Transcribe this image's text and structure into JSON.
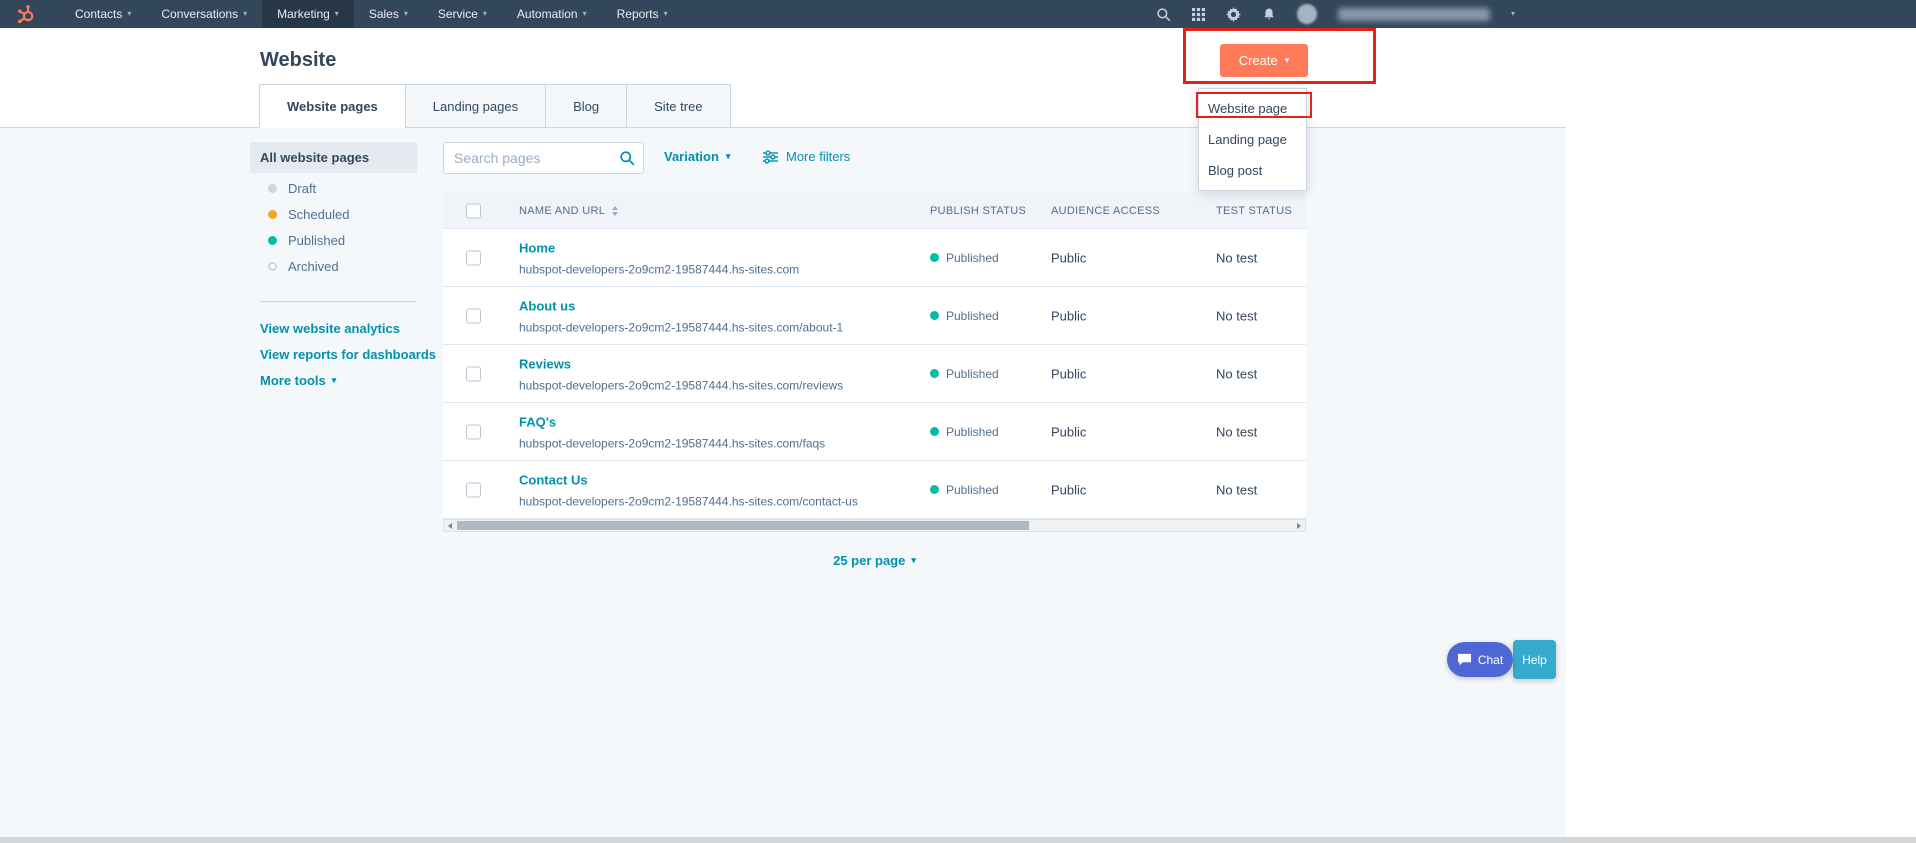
{
  "colors": {
    "nav_bg": "#33475b",
    "accent_orange": "#ff7a59",
    "link_teal": "#0091ae",
    "draft_dot": "#cbd6e2",
    "scheduled_dot": "#f5a623",
    "published_dot": "#00bda5",
    "annotation_red": "#e2231a",
    "chat_bg": "#4e67d5",
    "help_bg": "#35aacd"
  },
  "topnav": {
    "items": [
      {
        "label": "Contacts"
      },
      {
        "label": "Conversations"
      },
      {
        "label": "Marketing"
      },
      {
        "label": "Sales"
      },
      {
        "label": "Service"
      },
      {
        "label": "Automation"
      },
      {
        "label": "Reports"
      }
    ]
  },
  "page": {
    "title": "Website",
    "create_button": "Create"
  },
  "tabs": [
    {
      "label": "Website pages"
    },
    {
      "label": "Landing pages"
    },
    {
      "label": "Blog"
    },
    {
      "label": "Site tree"
    }
  ],
  "create_menu": {
    "items": [
      {
        "label": "Website page"
      },
      {
        "label": "Landing page"
      },
      {
        "label": "Blog post"
      }
    ]
  },
  "sidebar": {
    "selected_filter": "All website pages",
    "statuses": [
      {
        "label": "Draft"
      },
      {
        "label": "Scheduled"
      },
      {
        "label": "Published"
      },
      {
        "label": "Archived"
      }
    ],
    "links": [
      {
        "label": "View website analytics"
      },
      {
        "label": "View reports for dashboards"
      }
    ],
    "more_tools": "More tools"
  },
  "toolbar": {
    "search_placeholder": "Search pages",
    "variation": "Variation",
    "more_filters": "More filters"
  },
  "table": {
    "columns": [
      "NAME AND URL",
      "PUBLISH STATUS",
      "AUDIENCE ACCESS",
      "TEST STATUS"
    ],
    "rows": [
      {
        "name": "Home",
        "url": "hubspot-developers-2o9cm2-19587444.hs-sites.com",
        "publish_status": "Published",
        "audience_access": "Public",
        "test_status": "No test"
      },
      {
        "name": "About us",
        "url": "hubspot-developers-2o9cm2-19587444.hs-sites.com/about-1",
        "publish_status": "Published",
        "audience_access": "Public",
        "test_status": "No test"
      },
      {
        "name": "Reviews",
        "url": "hubspot-developers-2o9cm2-19587444.hs-sites.com/reviews",
        "publish_status": "Published",
        "audience_access": "Public",
        "test_status": "No test"
      },
      {
        "name": "FAQ's",
        "url": "hubspot-developers-2o9cm2-19587444.hs-sites.com/faqs",
        "publish_status": "Published",
        "audience_access": "Public",
        "test_status": "No test"
      },
      {
        "name": "Contact Us",
        "url": "hubspot-developers-2o9cm2-19587444.hs-sites.com/contact-us",
        "publish_status": "Published",
        "audience_access": "Public",
        "test_status": "No test"
      }
    ]
  },
  "pagination": {
    "per_page": "25 per page"
  },
  "support": {
    "chat_label": "Chat",
    "help_label": "Help"
  }
}
